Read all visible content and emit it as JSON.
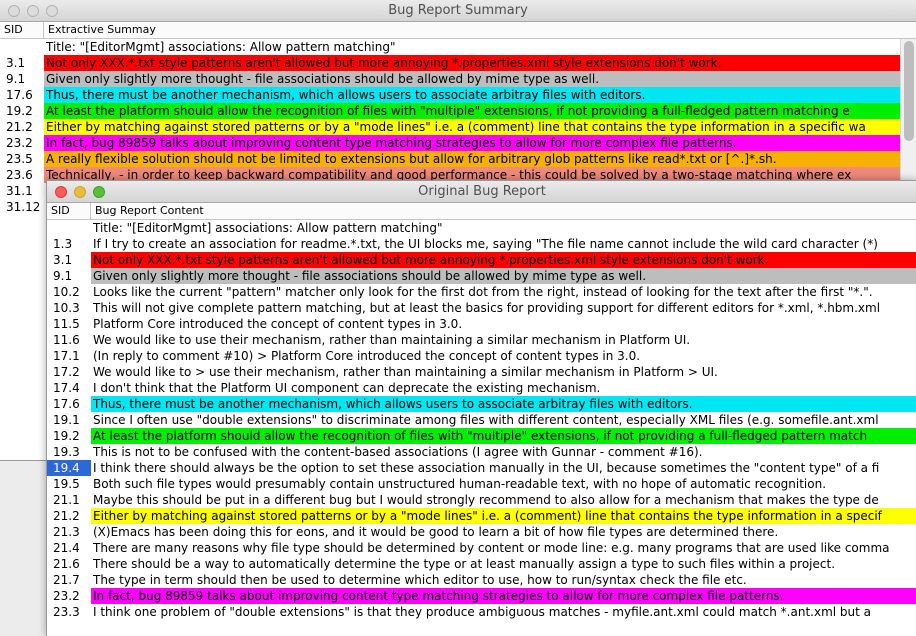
{
  "summary_window": {
    "title": "Bug Report Summary",
    "columns": {
      "sid": "SID",
      "content": "Extractive Summay"
    },
    "rows": [
      {
        "sid": "",
        "text": "Title: \"[EditorMgmt] associations: Allow pattern matching\"",
        "color": ""
      },
      {
        "sid": "3.1",
        "text": "Not  only XXX.*.txt style patterns aren't allowed but more annoying *.properties.xml style extensions don't work.",
        "color": "red"
      },
      {
        "sid": "9.1",
        "text": "Given  only slightly more thought - file associations should be allowed by mime type as well.",
        "color": "gray"
      },
      {
        "sid": "17.6",
        "text": "Thus, there must be another mechanism, which allows users to associate arbitray files with editors.",
        "color": "cyan"
      },
      {
        "sid": "19.2",
        "text": "At  least the platform should allow the recognition of files with \"multiple\" extensions, if not providing a full-fledged pattern matching e",
        "color": "green"
      },
      {
        "sid": "21.2",
        "text": "Either  by matching against stored patterns or by a \"mode lines\" i.e. a (comment) line that contains the type information in a specific wa",
        "color": "yellow"
      },
      {
        "sid": "23.2",
        "text": "In  fact, bug 89859 talks about improving content type matching strategies to allow for more complex file patterns.",
        "color": "magenta"
      },
      {
        "sid": "23.5",
        "text": "A  really flexible solution should not be limited to extensions but allow for arbitrary glob patterns like read*.txt or [^.]*.sh.",
        "color": "orange"
      },
      {
        "sid": "23.6",
        "text": "Technically, - in order to keep backward compatibility and good performance - this could be solved by a two-stage matching where ex",
        "color": "salmon"
      },
      {
        "sid": "31.1",
        "text": "",
        "color": ""
      },
      {
        "sid": "31.12",
        "text": "",
        "color": ""
      }
    ]
  },
  "original_window": {
    "title": "Original Bug Report",
    "columns": {
      "sid": "SID",
      "content": "Bug Report Content"
    },
    "rows": [
      {
        "sid": "",
        "text": "Title: \"[EditorMgmt] associations: Allow pattern matching\"",
        "color": ""
      },
      {
        "sid": "1.3",
        "text": "If  I try to create an association for readme.*.txt, the UI blocks me, saying \"The file name cannot include the wild card character (*)",
        "color": ""
      },
      {
        "sid": "3.1",
        "text": "Not  only XXX.*.txt style patterns aren't allowed but more annoying *.properties.xml style extensions don't work.",
        "color": "red"
      },
      {
        "sid": "9.1",
        "text": "Given  only slightly more thought - file associations should be allowed by mime type as well.",
        "color": "gray"
      },
      {
        "sid": "10.2",
        "text": "Looks  like the current \"pattern\" matcher only look for the first dot from the right, instead of looking for the text after the first \"*.\".",
        "color": ""
      },
      {
        "sid": "10.3",
        "text": "This  will not give complete pattern matching, but at least the basics for providing support for different editors for *.xml, *.hbm.xml",
        "color": ""
      },
      {
        "sid": "11.5",
        "text": "Platform  Core introduced the concept of content types in 3.0.",
        "color": ""
      },
      {
        "sid": "11.6",
        "text": "We  would like to use their mechanism, rather than maintaining a similar mechanism in Platform UI.",
        "color": ""
      },
      {
        "sid": "17.1",
        "text": "(In  reply to comment #10) > Platform Core introduced the concept of content types in 3.0.",
        "color": ""
      },
      {
        "sid": "17.2",
        "text": "We  would like to > use their mechanism, rather than maintaining a similar mechanism in Platform > UI.",
        "color": ""
      },
      {
        "sid": "17.4",
        "text": "I  don't think that the Platform UI component can deprecate the existing mechanism.",
        "color": ""
      },
      {
        "sid": "17.6",
        "text": "Thus,  there must be another mechanism, which allows users to associate arbitray files with editors.",
        "color": "cyan"
      },
      {
        "sid": "19.1",
        "text": "Since  I often use \"double extensions\" to discriminate among files with different content, especially XML files (e.g. somefile.ant.xml",
        "color": ""
      },
      {
        "sid": "19.2",
        "text": "At  least the platform should allow the recognition of files with \"multiple\" extensions, if not providing a full-fledged pattern match",
        "color": "green"
      },
      {
        "sid": "19.3",
        "text": "This  is not to be confused with the content-based associations (I agree with Gunnar - comment #16).",
        "color": ""
      },
      {
        "sid": "19.4",
        "text": "I  think there should always be the option to set these association manually in the UI, because sometimes the \"content type\" of a fi",
        "color": "",
        "selected": true
      },
      {
        "sid": "19.5",
        "text": "Both  such file types would presumably contain unstructured human-readable text, with no hope of automatic recognition.",
        "color": ""
      },
      {
        "sid": "21.1",
        "text": "Maybe  this should be put in a different bug but I would strongly recommend to also allow for a mechanism that makes the type de",
        "color": ""
      },
      {
        "sid": "21.2",
        "text": "Either  by matching against stored patterns or by a \"mode lines\" i.e. a (comment) line that contains the type information in a specif",
        "color": "yellow"
      },
      {
        "sid": "21.3",
        "text": "(X)Emacs  has been doing this for eons, and it would be good to learn a bit of how file types are determined there.",
        "color": ""
      },
      {
        "sid": "21.4",
        "text": "There  are many reasons why file type should be determined by content or mode line: e.g. many programs that are used like comma",
        "color": ""
      },
      {
        "sid": "21.6",
        "text": "There  should be a way to automatically determine the type or at least manually assign a type to such files within a project.",
        "color": ""
      },
      {
        "sid": "21.7",
        "text": "The  type in term should then be used to determine which editor to use, how to run/syntax check the file etc.",
        "color": ""
      },
      {
        "sid": "23.2",
        "text": "In  fact, bug 89859 talks about improving content type matching strategies to allow for more complex file patterns.",
        "color": "magenta"
      },
      {
        "sid": "23.3",
        "text": "I  think one problem of \"double extensions\" is that they produce ambiguous matches - myfile.ant.xml could match *.ant.xml but a",
        "color": ""
      }
    ]
  }
}
